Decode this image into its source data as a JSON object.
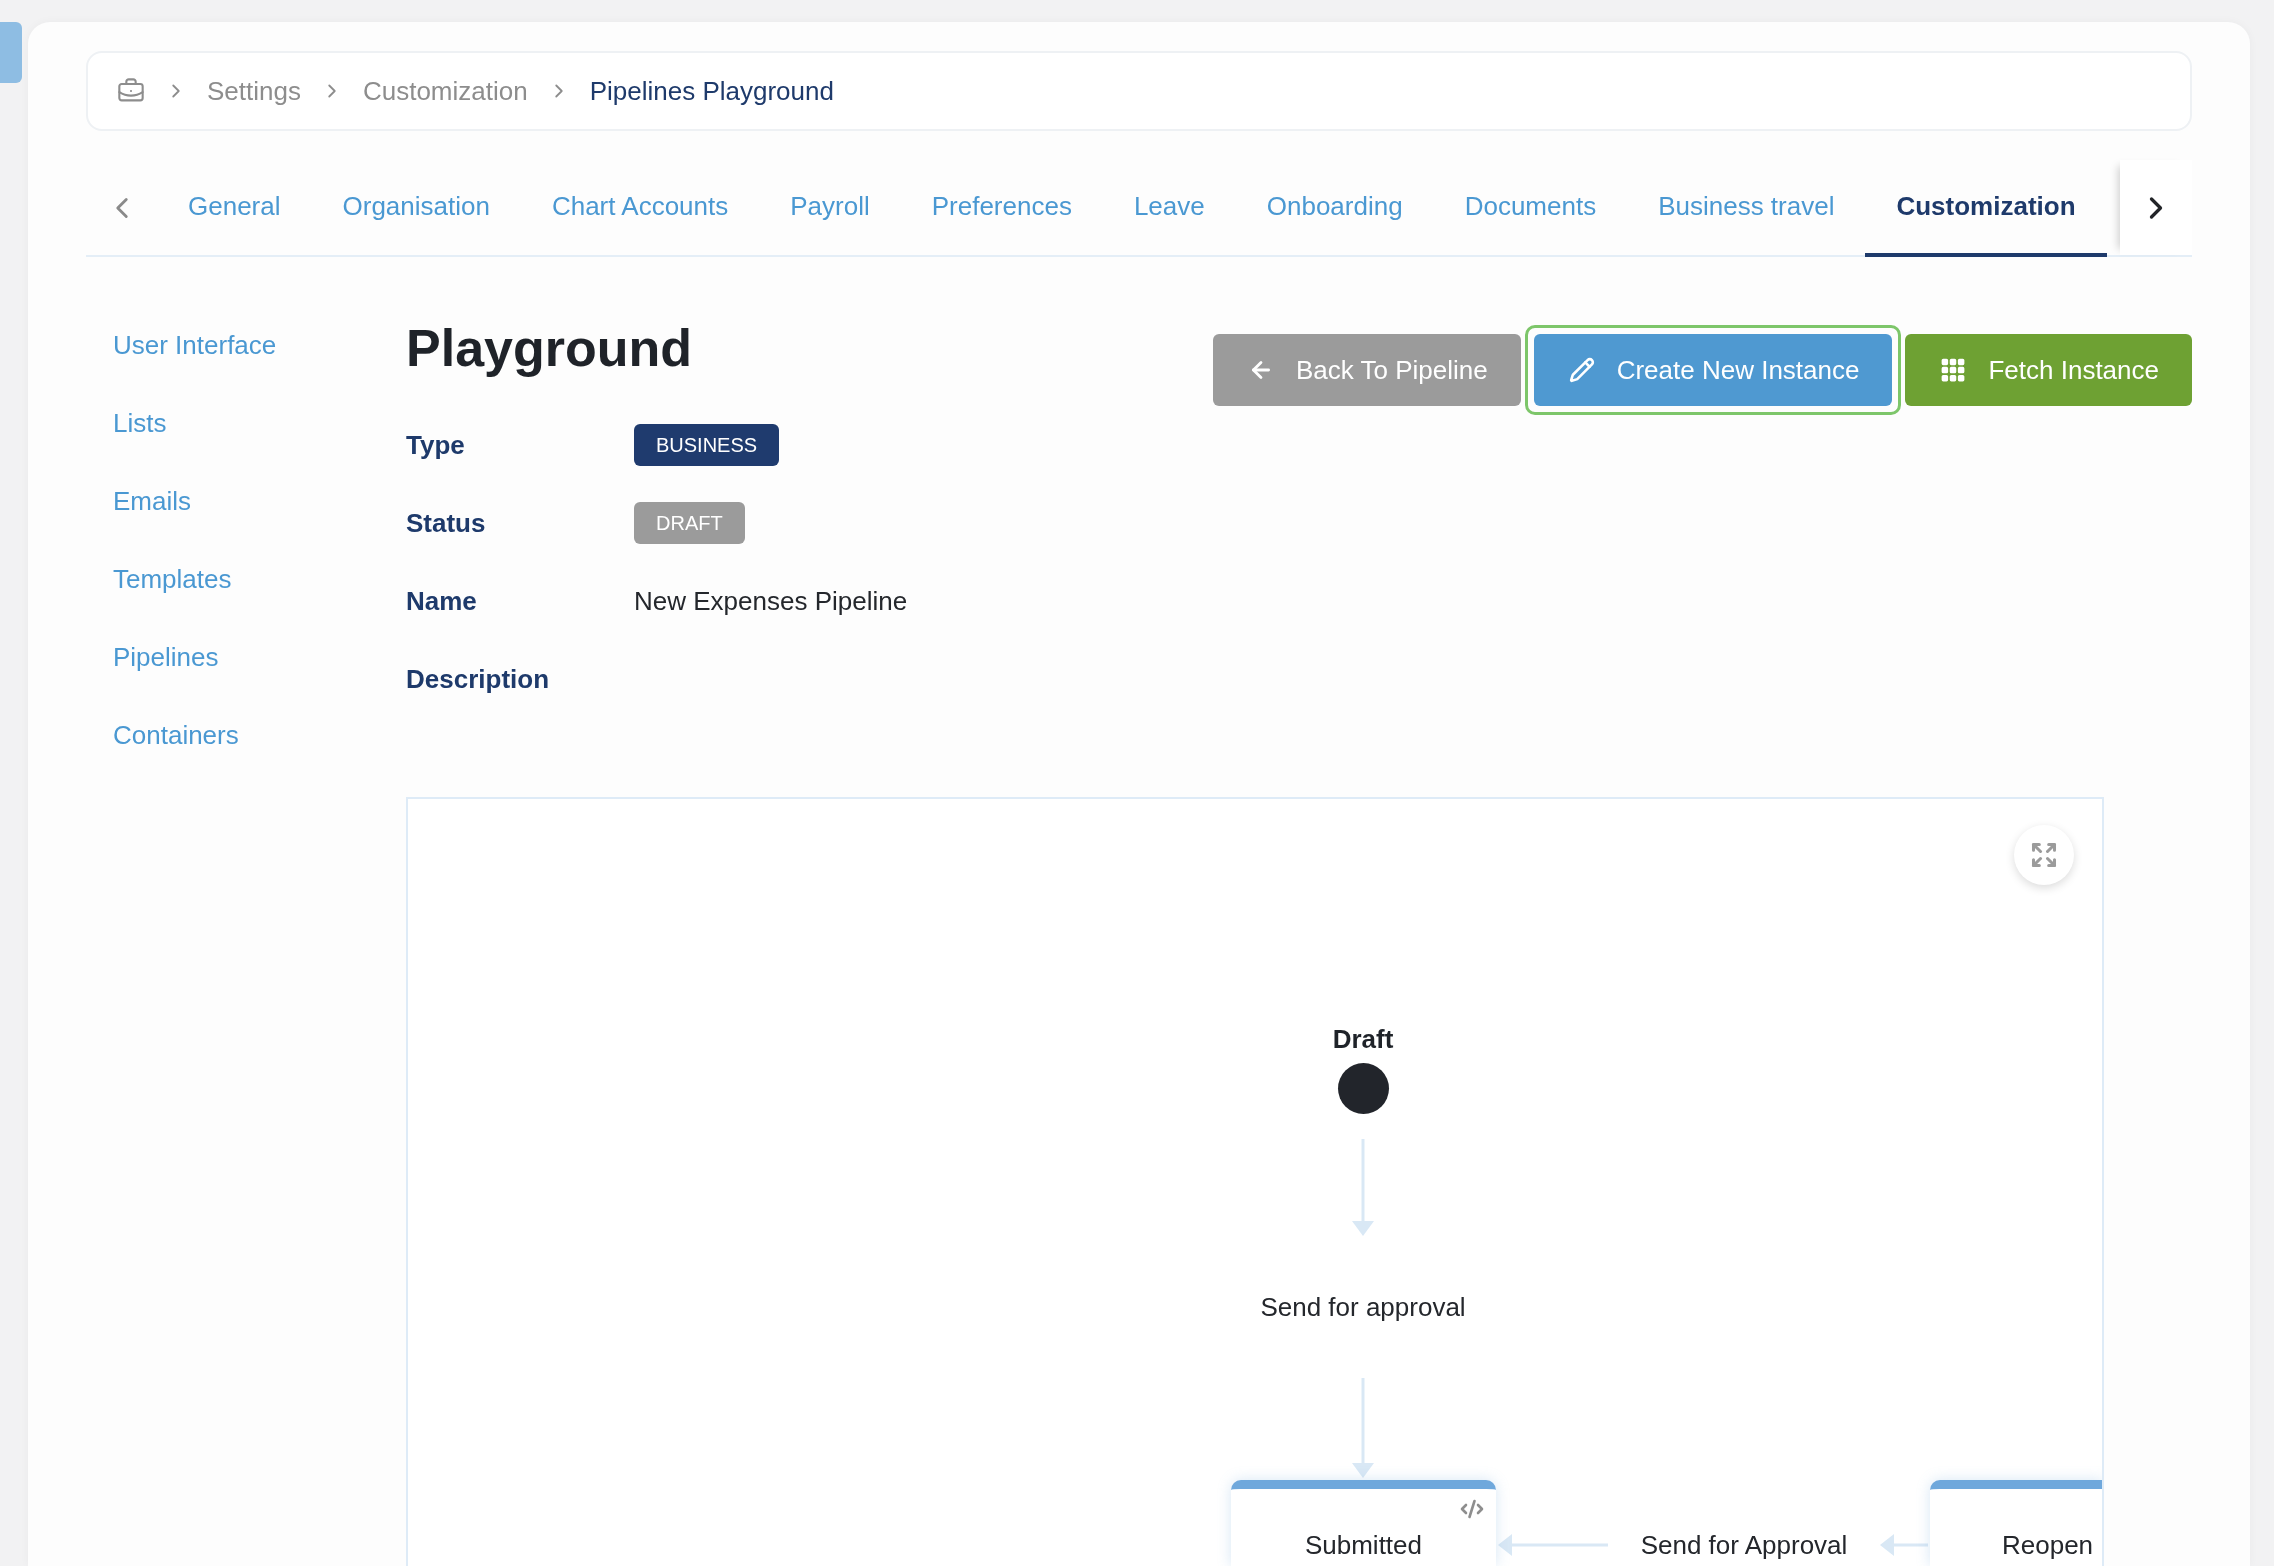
{
  "breadcrumb": [
    {
      "label": "Settings",
      "current": false
    },
    {
      "label": "Customization",
      "current": false
    },
    {
      "label": "Pipelines Playground",
      "current": true
    }
  ],
  "tabs": [
    {
      "label": "General",
      "selected": false
    },
    {
      "label": "Organisation",
      "selected": false
    },
    {
      "label": "Chart Accounts",
      "selected": false
    },
    {
      "label": "Payroll",
      "selected": false
    },
    {
      "label": "Preferences",
      "selected": false
    },
    {
      "label": "Leave",
      "selected": false
    },
    {
      "label": "Onboarding",
      "selected": false
    },
    {
      "label": "Documents",
      "selected": false
    },
    {
      "label": "Business travel",
      "selected": false
    },
    {
      "label": "Customization",
      "selected": true
    }
  ],
  "sidebar": [
    "User Interface",
    "Lists",
    "Emails",
    "Templates",
    "Pipelines",
    "Containers"
  ],
  "page": {
    "title": "Playground",
    "actions": [
      {
        "kind": "back",
        "label": "Back To Pipeline",
        "focused": false
      },
      {
        "kind": "create",
        "label": "Create New Instance",
        "focused": true
      },
      {
        "kind": "fetch",
        "label": "Fetch Instance",
        "focused": false
      }
    ]
  },
  "details": [
    {
      "label": "Type",
      "kind": "badge",
      "value": "BUSINESS",
      "color": "#1f3b6e"
    },
    {
      "label": "Status",
      "kind": "badge",
      "value": "DRAFT",
      "color": "#9b9b9b"
    },
    {
      "label": "Name",
      "kind": "text",
      "value": "New Expenses Pipeline"
    },
    {
      "label": "Description",
      "kind": "text"
    }
  ],
  "diagram": {
    "start": {
      "label": "Draft"
    },
    "transitions": [
      {
        "label": "Send for approval"
      },
      {
        "label": "Send for Approval"
      }
    ],
    "states": [
      {
        "label": "Submitted"
      },
      {
        "label": "Reopen"
      }
    ]
  }
}
